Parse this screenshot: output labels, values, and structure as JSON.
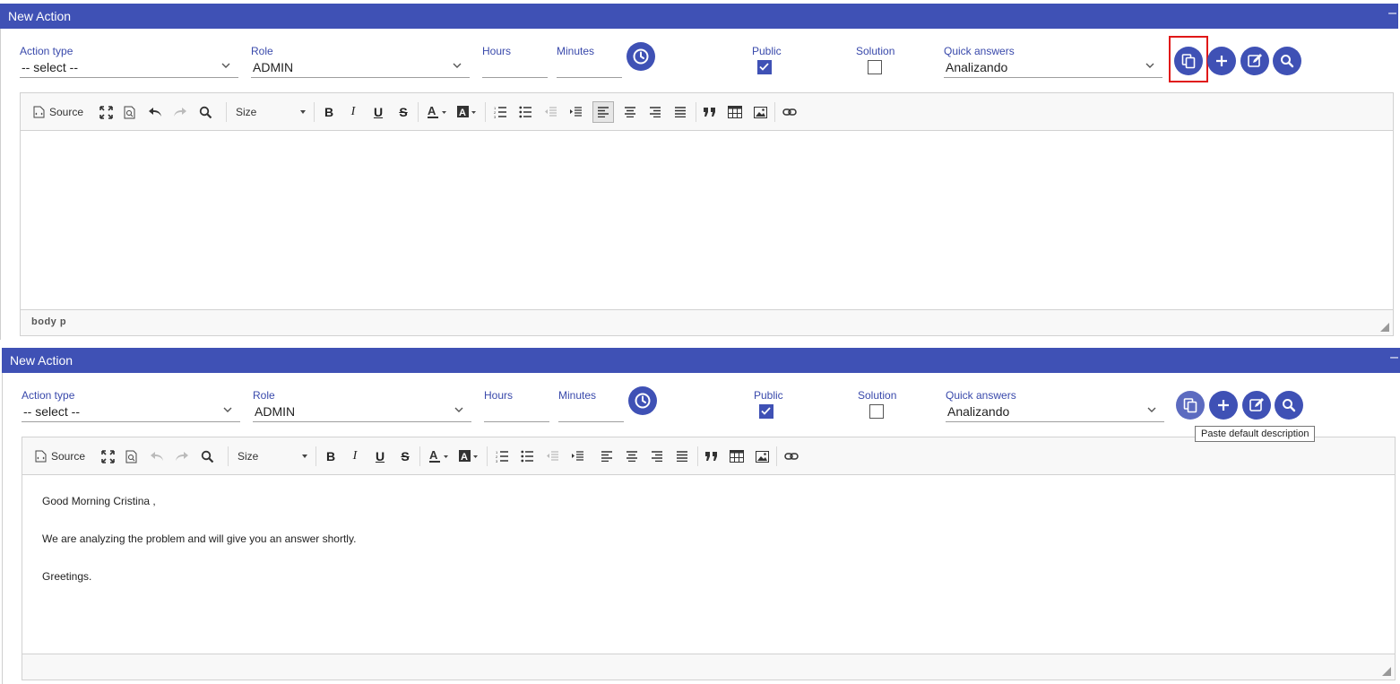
{
  "panels": [
    {
      "header": {
        "title": "New Action",
        "minimize": "–"
      },
      "fields": {
        "action_type": {
          "label": "Action type",
          "value": "-- select --"
        },
        "role": {
          "label": "Role",
          "value": "ADMIN"
        },
        "hours": {
          "label": "Hours",
          "value": ""
        },
        "minutes": {
          "label": "Minutes",
          "value": ""
        },
        "public": {
          "label": "Public",
          "checked": true
        },
        "solution": {
          "label": "Solution",
          "checked": false
        },
        "quick_answers": {
          "label": "Quick answers",
          "value": "Analizando"
        }
      },
      "toolbar": {
        "source_label": "Source",
        "size_label": "Size"
      },
      "content": [],
      "status_path": "body  p"
    },
    {
      "header": {
        "title": "New Action",
        "minimize": "–"
      },
      "fields": {
        "action_type": {
          "label": "Action type",
          "value": "-- select --"
        },
        "role": {
          "label": "Role",
          "value": "ADMIN"
        },
        "hours": {
          "label": "Hours",
          "value": ""
        },
        "minutes": {
          "label": "Minutes",
          "value": ""
        },
        "public": {
          "label": "Public",
          "checked": true
        },
        "solution": {
          "label": "Solution",
          "checked": false
        },
        "quick_answers": {
          "label": "Quick answers",
          "value": "Analizando"
        }
      },
      "toolbar": {
        "source_label": "Source",
        "size_label": "Size"
      },
      "content": [
        "Good Morning Cristina ,",
        "We are analyzing the problem and will give you an answer shortly.",
        "Greetings."
      ],
      "status_path": ""
    }
  ],
  "tooltip": {
    "text": "Paste default description"
  },
  "icons": {
    "paste": "paste-icon",
    "add": "plus-icon",
    "edit": "edit-icon",
    "search": "search-icon",
    "clock": "clock-icon"
  },
  "colors": {
    "primary": "#3f51b5",
    "highlight": "#e01818"
  }
}
